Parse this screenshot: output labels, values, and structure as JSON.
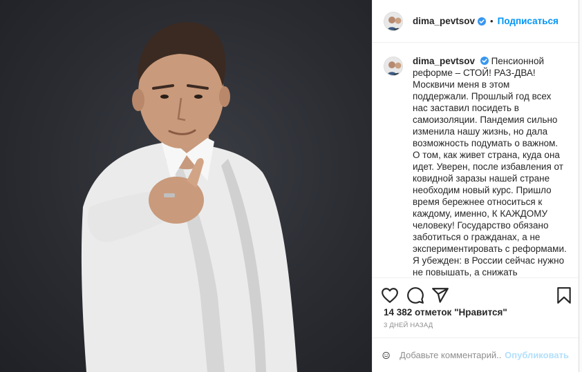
{
  "post": {
    "photo_alt": "Portrait of a man in a white shirt pointing at the viewer",
    "author": {
      "username": "dima_pevtsov",
      "verified": true,
      "verified_icon": "verified-badge-icon"
    },
    "header": {
      "separator": "•",
      "follow_label": "Подписаться"
    },
    "caption": {
      "username": "dima_pevtsov",
      "text": "Пенсионной реформе – СТОЙ! РАЗ-ДВА! Москвичи меня в этом поддержали. Прошлый год всех нас заставил посидеть в самоизоляции. Пандемия сильно изменила нашу жизнь, но дала возможность подумать о важном. О том, как живет страна, куда она идет. Уверен, после избавления от ковидной заразы нашей стране необходим новый курс. Пришло время бережнее относиться к каждому, именно, К КАЖДОМУ человеку! Государство обязано заботиться о гражданах, а не экспериментировать с реформами. Я убежден: в России сейчас нужно не повышать, а снижать пенсионный возраст. Надо дать людям возможность пожить"
    },
    "actions": {
      "like_icon": "heart-icon",
      "comment_icon": "comment-icon",
      "share_icon": "share-icon",
      "save_icon": "bookmark-icon"
    },
    "likes_text": "14 382 отметок \"Нравится\"",
    "time_ago": "3 ДНЕЙ НАЗАД",
    "comment": {
      "emoji_icon": "emoji-icon",
      "placeholder": "Добавьте комментарий...",
      "publish_label": "Опубликовать"
    },
    "colors": {
      "accent": "#0095f6",
      "publish_disabled": "#b2dffc",
      "muted": "#8e8e8e",
      "background_photo": "#2a2c32"
    }
  }
}
